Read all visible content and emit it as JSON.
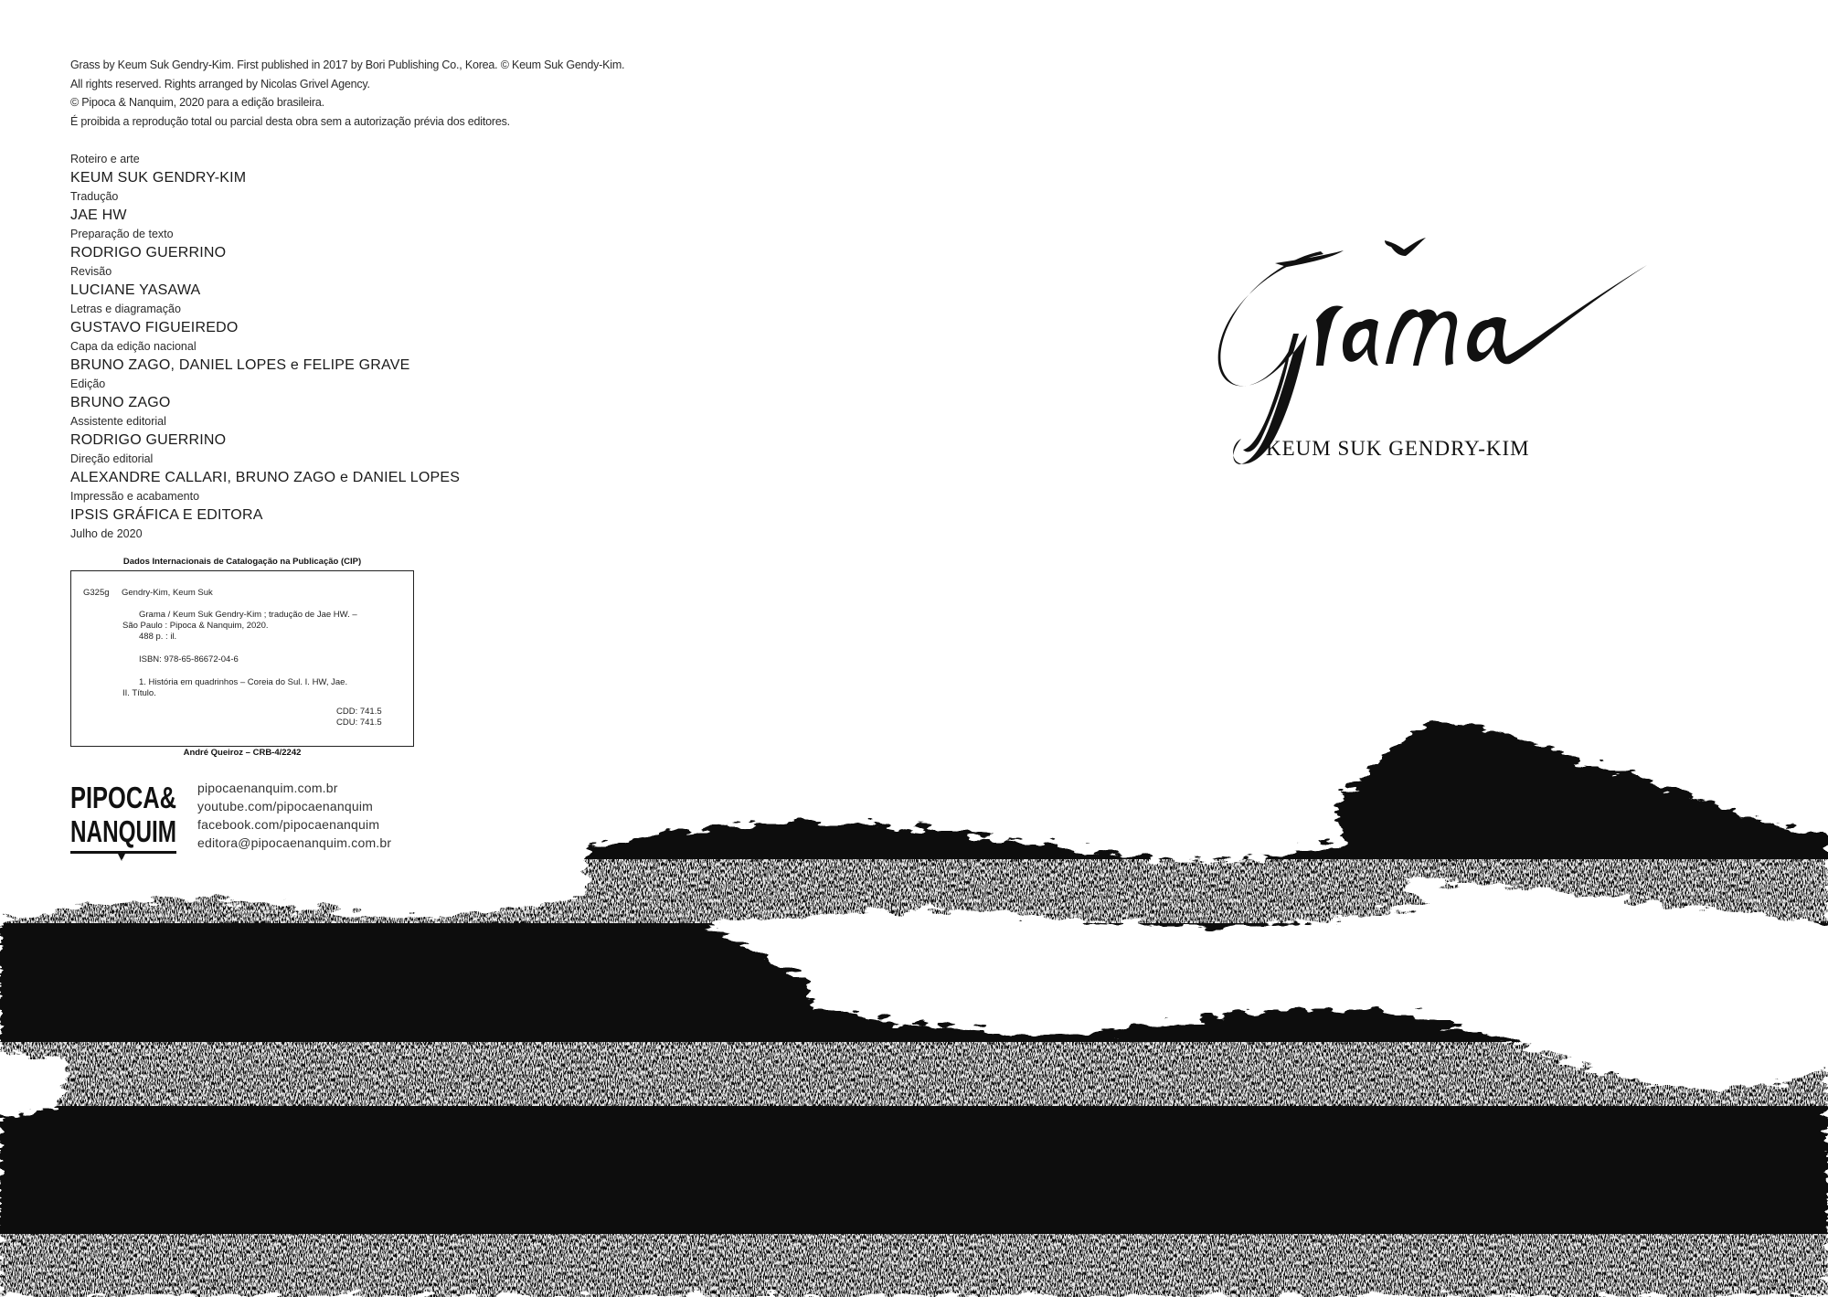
{
  "copyright": [
    "Grass by Keum Suk Gendry-Kim. First published in 2017 by Bori Publishing Co., Korea. © Keum Suk Gendy-Kim.",
    "All rights reserved. Rights arranged by Nicolas Grivel Agency.",
    "© Pipoca & Nanquim, 2020 para a edição brasileira.",
    "É proibida a reprodução total ou parcial desta obra sem a autorização prévia dos editores."
  ],
  "credits": [
    {
      "role": "Roteiro e arte",
      "name": "KEUM SUK GENDRY-KIM"
    },
    {
      "role": "Tradução",
      "name": "JAE HW"
    },
    {
      "role": "Preparação de texto",
      "name": "RODRIGO GUERRINO"
    },
    {
      "role": "Revisão",
      "name": "LUCIANE YASAWA"
    },
    {
      "role": "Letras e diagramação",
      "name": "GUSTAVO FIGUEIREDO"
    },
    {
      "role": "Capa da edição nacional",
      "name": "BRUNO ZAGO, DANIEL LOPES e FELIPE GRAVE"
    },
    {
      "role": "Edição",
      "name": "BRUNO ZAGO"
    },
    {
      "role": "Assistente editorial",
      "name": "RODRIGO GUERRINO"
    },
    {
      "role": "Direção editorial",
      "name": "ALEXANDRE CALLARI, BRUNO ZAGO e DANIEL LOPES"
    },
    {
      "role": "Impressão e acabamento",
      "name": "IPSIS GRÁFICA E EDITORA"
    }
  ],
  "date": "Julho de 2020",
  "cip": {
    "heading": "Dados Internacionais de Catalogação na Publicação (CIP)",
    "code": "G325g",
    "author": "Gendry-Kim, Keum Suk",
    "title_line1": "Grama / Keum Suk Gendry-Kim ; tradução de Jae HW. –",
    "title_line2": "São Paulo : Pipoca & Nanquim, 2020.",
    "pages": "488 p. : il.",
    "isbn": "ISBN: 978-65-86672-04-6",
    "subjects_line1": "1. História em quadrinhos – Coreia do Sul. I. HW, Jae.",
    "subjects_line2": "II. Título.",
    "cdd": "CDD: 741.5",
    "cdu": "CDU: 741.5",
    "librarian": "André Queiroz – CRB-4/2242"
  },
  "publisher": {
    "logo_line1": "PIPOCA&",
    "logo_line2": "NANQUIM",
    "links": [
      "pipocaenanquim.com.br",
      "youtube.com/pipocaenanquim",
      "facebook.com/pipocaenanquim",
      "editora@pipocaenanquim.com.br"
    ]
  },
  "cover": {
    "title": "Grama",
    "author": "KEUM SUK GENDRY-KIM"
  },
  "colors": {
    "ink": "#111111",
    "paper": "#ffffff"
  }
}
